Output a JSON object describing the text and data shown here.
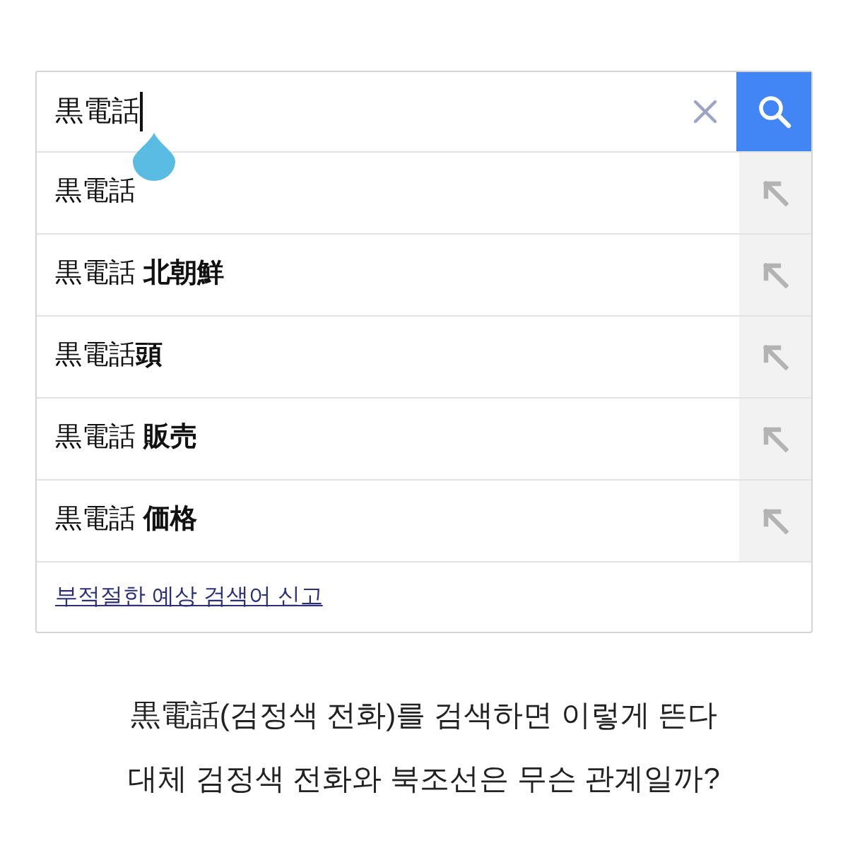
{
  "search": {
    "value": "黒電話"
  },
  "suggestions": [
    {
      "text": "黒電話"
    },
    {
      "text": "黒電話 **北朝鮮**"
    },
    {
      "text": "黒電話**頭**"
    },
    {
      "text": "黒電話 **販売**"
    },
    {
      "text": "黒電話 **価格**"
    }
  ],
  "report_link": "부적절한 예상 검색어 신고",
  "caption": [
    "黒電話(검정색 전화)를 검색하면 이렇게 뜬다",
    "대체 검정색 전화와 북조선은 무슨 관계일까?"
  ]
}
